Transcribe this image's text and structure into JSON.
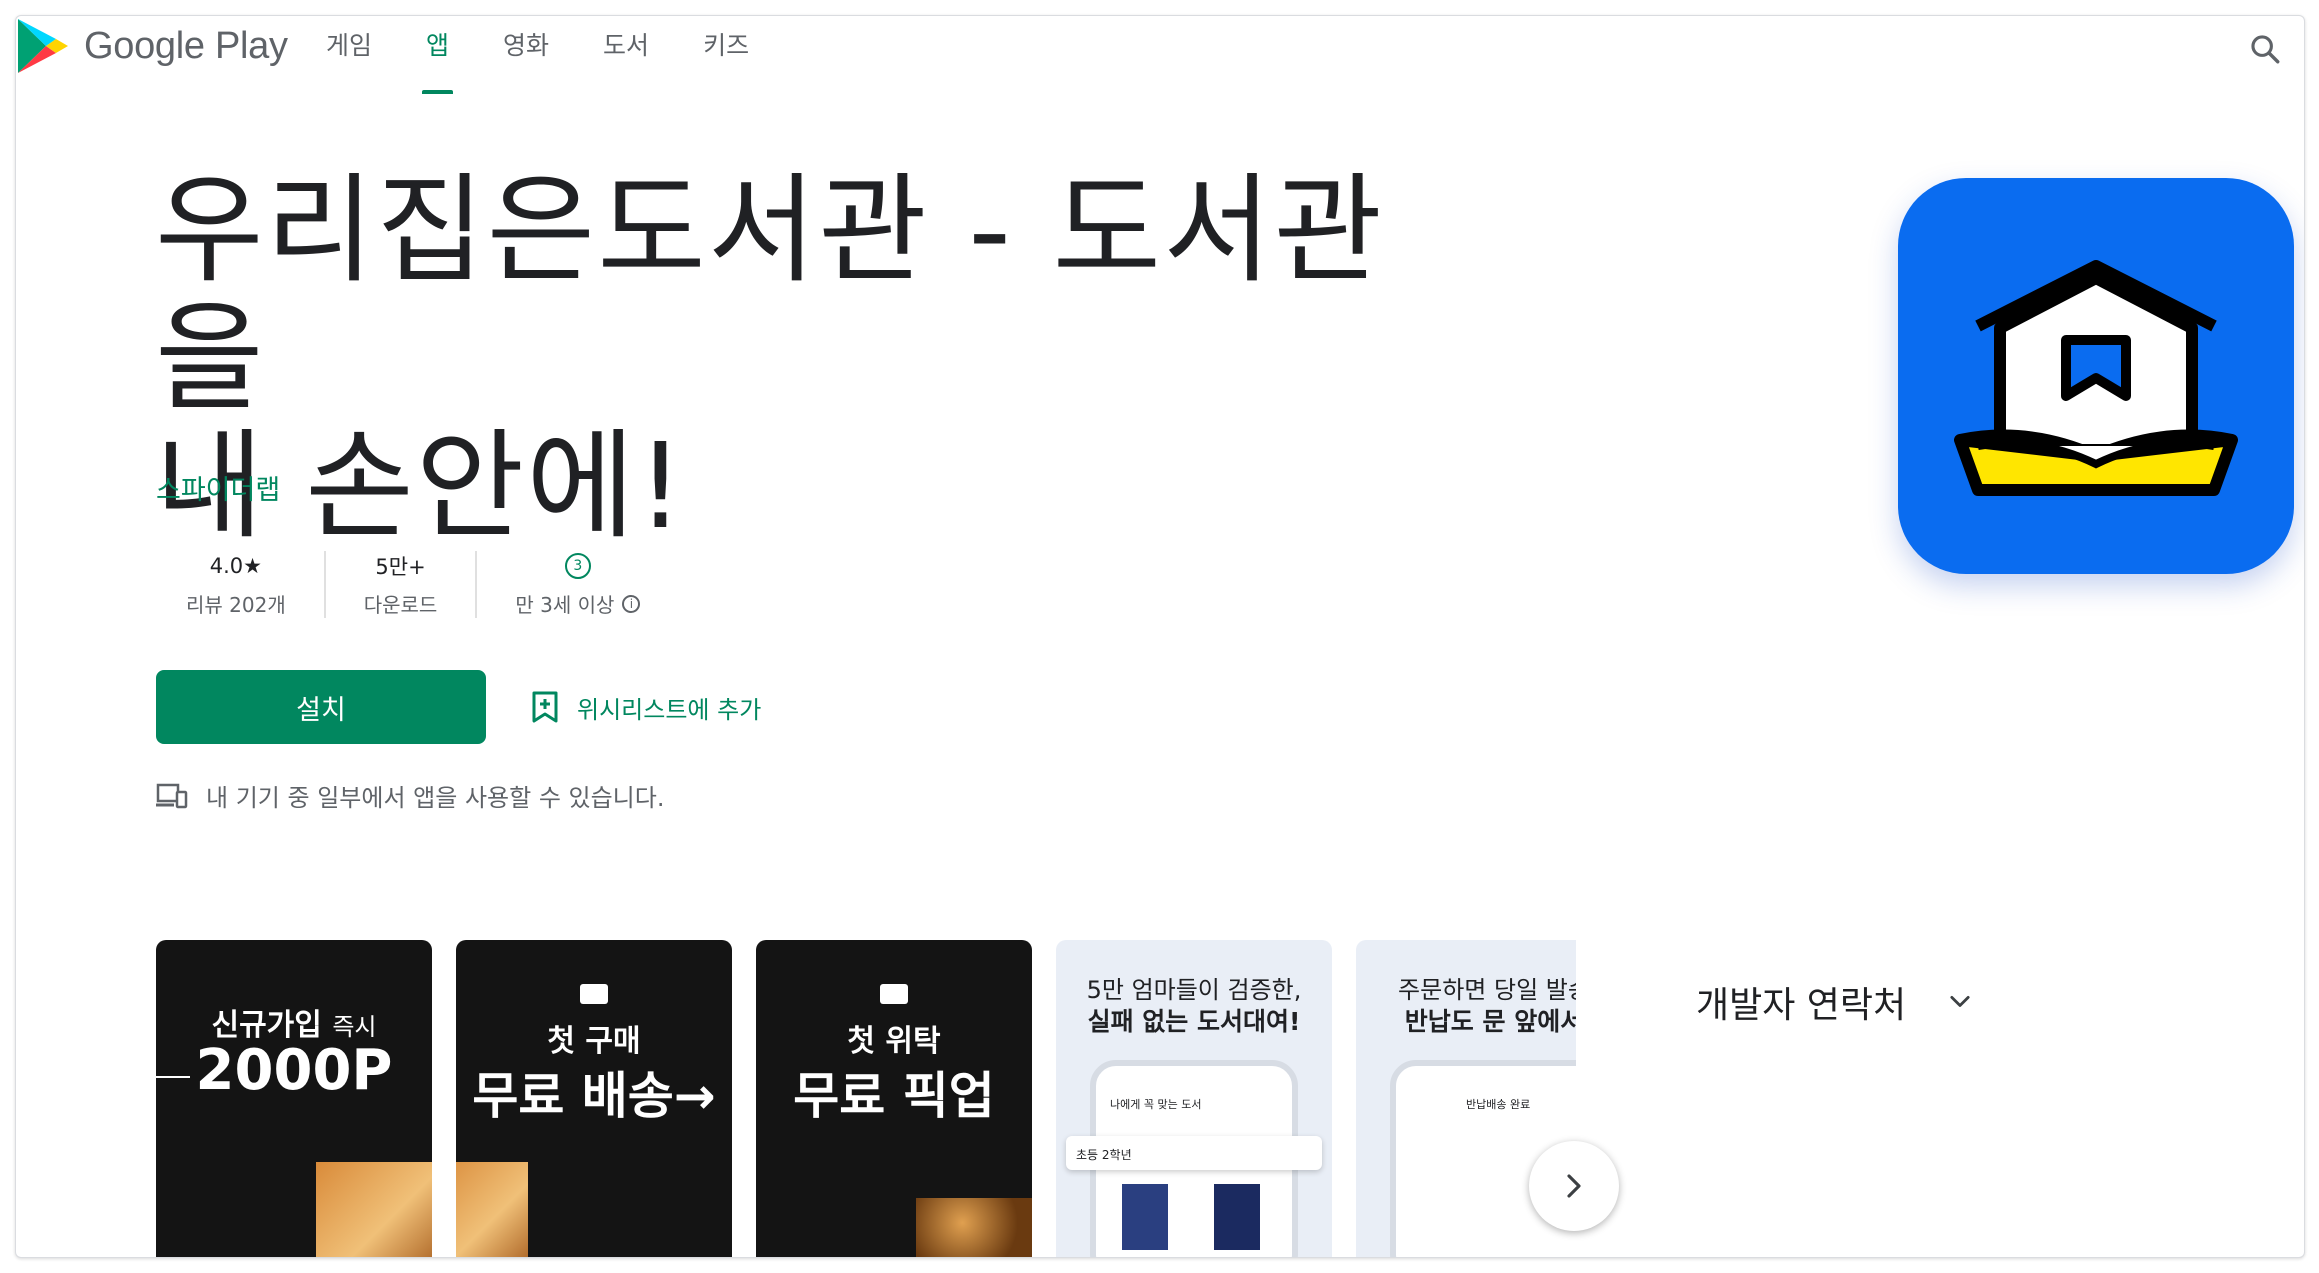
{
  "header": {
    "brand": "Google Play",
    "nav": [
      {
        "label": "게임",
        "active": false
      },
      {
        "label": "앱",
        "active": true
      },
      {
        "label": "영화",
        "active": false
      },
      {
        "label": "도서",
        "active": false
      },
      {
        "label": "키즈",
        "active": false
      }
    ],
    "search_icon": "search-icon"
  },
  "app": {
    "title_line1": "우리집은도서관 - 도서관을",
    "title_line2": "내 손안에!",
    "developer": "스파이더랩",
    "stats": {
      "rating_value": "4.0★",
      "rating_label": "리뷰 202개",
      "downloads_value": "5만+",
      "downloads_label": "다운로드",
      "age_badge": "3",
      "age_label": "만 3세 이상"
    },
    "install_label": "설치",
    "wishlist_label": "위시리스트에 추가",
    "device_note": "내 기기 중 일부에서 앱을 사용할 수 있습니다.",
    "icon_colors": {
      "background": "#0a6cf0",
      "book": "#ffe600"
    }
  },
  "screenshots": [
    {
      "line1": "신규가입",
      "line1_small": "즉시",
      "line2": "2000P"
    },
    {
      "line1": "첫 구매",
      "line2": "무료 배송→"
    },
    {
      "line1": "첫 위탁",
      "line2": "무료 픽업"
    },
    {
      "line1": "5만 엄마들이 검증한,",
      "line2": "실패 없는 도서대여!",
      "phone_title": "나에게 꼭 맞는 도서",
      "phone_chip": "초등 2학년"
    },
    {
      "line1": "주문하면 당일 발송",
      "line2": "반납도 문 앞에서",
      "phone_title": "반납배송 완료"
    }
  ],
  "developer_contact": "개발자 연락처",
  "colors": {
    "accent": "#01875f",
    "text": "#202124",
    "muted": "#5f6368"
  }
}
